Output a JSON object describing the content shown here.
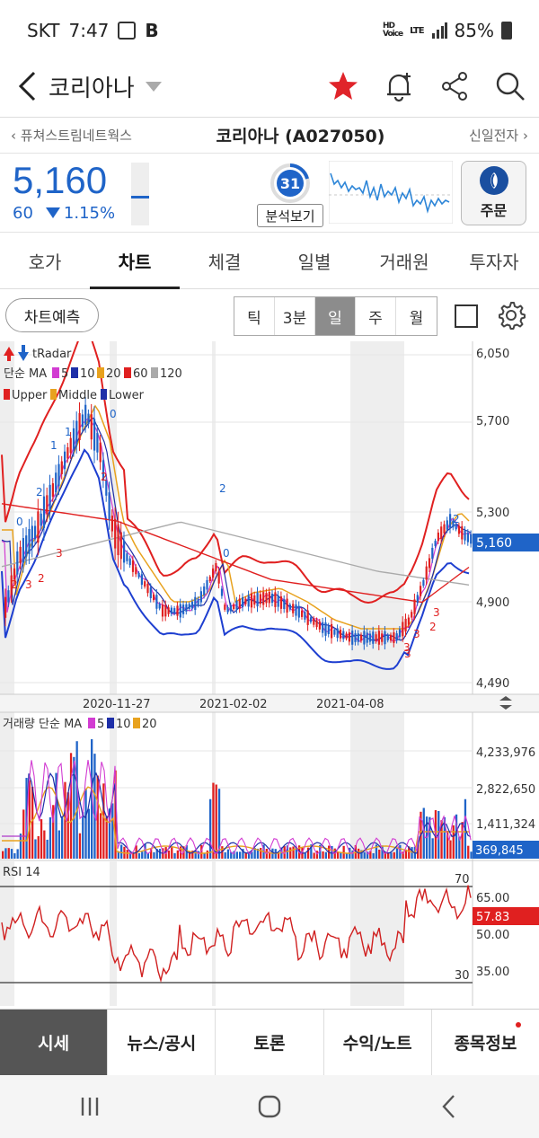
{
  "status_bar": {
    "carrier": "SKT",
    "time": "7:47",
    "b_icon": "B",
    "hd_label": "HD",
    "voice_label": "Voice",
    "lte_label": "LTE",
    "battery": "85%"
  },
  "header": {
    "title": "코리아나",
    "icons": [
      "back-icon",
      "star-icon",
      "bell-plus-icon",
      "share-icon",
      "search-icon"
    ]
  },
  "nav": {
    "prev": "퓨쳐스트림네트웍스",
    "current": "코리아나 (A027050)",
    "next": "신일전자"
  },
  "quote": {
    "price": "5,160",
    "change": "60",
    "change_pct": "1.15%",
    "direction": "down",
    "score": "31",
    "analysis_label": "분석보기",
    "order_label": "주문"
  },
  "tabs": [
    {
      "label": "호가",
      "active": false
    },
    {
      "label": "차트",
      "active": true
    },
    {
      "label": "체결",
      "active": false
    },
    {
      "label": "일별",
      "active": false
    },
    {
      "label": "거래원",
      "active": false
    },
    {
      "label": "투자자",
      "active": false
    }
  ],
  "toolbar": {
    "predict_label": "차트예측",
    "periods": [
      {
        "label": "틱",
        "active": false
      },
      {
        "label": "3분",
        "active": false
      },
      {
        "label": "일",
        "active": true
      },
      {
        "label": "주",
        "active": false
      },
      {
        "label": "월",
        "active": false
      }
    ]
  },
  "chart_data": [
    {
      "type": "candlestick",
      "legend_radar": "tRadar",
      "legend_ma_prefix": "단순 MA",
      "ma_periods": [
        "5",
        "10",
        "20",
        "60",
        "120"
      ],
      "ma_colors": [
        "#d23cd2",
        "#1e2fa8",
        "#e8a21e",
        "#e02020",
        "#aaaaaa"
      ],
      "bollinger_labels": [
        "Upper",
        "Middle",
        "Lower"
      ],
      "y_ticks": [
        "6,050",
        "5,700",
        "5,300",
        "4,900",
        "4,490"
      ],
      "ylim": [
        4490,
        6050
      ],
      "x_ticks": [
        "2020-11-27",
        "2021-02-02",
        "2021-04-08"
      ],
      "current_price_label": "5,160",
      "current_price": 5160
    },
    {
      "type": "bar",
      "title": "거래량 단순 MA",
      "ma_periods": [
        "5",
        "10",
        "20"
      ],
      "y_ticks": [
        "4,233,976",
        "2,822,650",
        "1,411,324"
      ],
      "current_volume_label": "369,845"
    },
    {
      "type": "line",
      "title": "RSI 14",
      "y_ticks": [
        "65.00",
        "50.00",
        "35.00"
      ],
      "upper_line_label": "70",
      "lower_line_label": "30",
      "current_label": "57.83",
      "current_value": 57.83
    }
  ],
  "bottom_tabs": [
    {
      "label": "시세",
      "active": true
    },
    {
      "label": "뉴스/공시",
      "active": false
    },
    {
      "label": "토론",
      "active": false
    },
    {
      "label": "수익/노트",
      "active": false
    },
    {
      "label": "종목정보",
      "active": false
    }
  ]
}
